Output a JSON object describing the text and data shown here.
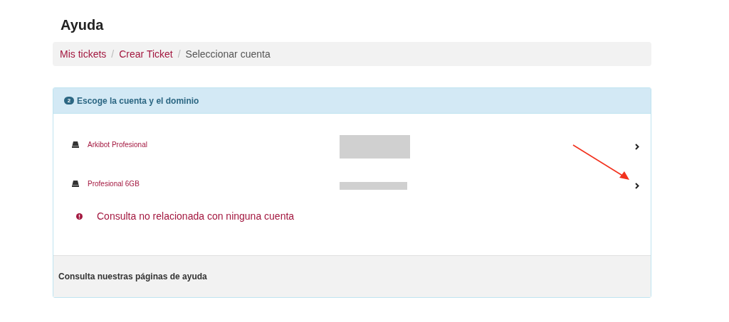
{
  "page_title": "Ayuda",
  "breadcrumb": [
    {
      "label": "Mis tickets",
      "kind": "link"
    },
    {
      "label": "/",
      "kind": "separator"
    },
    {
      "label": "Crear Ticket",
      "kind": "link"
    },
    {
      "label": "/",
      "kind": "separator"
    },
    {
      "label": "Seleccionar cuenta",
      "kind": "current"
    }
  ],
  "step": {
    "number": "2",
    "title": "Escoge la cuenta y el dominio"
  },
  "accounts": [
    {
      "name": "Arkibot Profesional",
      "kind": "tall"
    },
    {
      "name": "Profesional 6GB",
      "kind": "thin"
    }
  ],
  "no_account_option": "Consulta no relacionada con ninguna cuenta",
  "footer": "Consulta nuestras páginas de ayuda"
}
